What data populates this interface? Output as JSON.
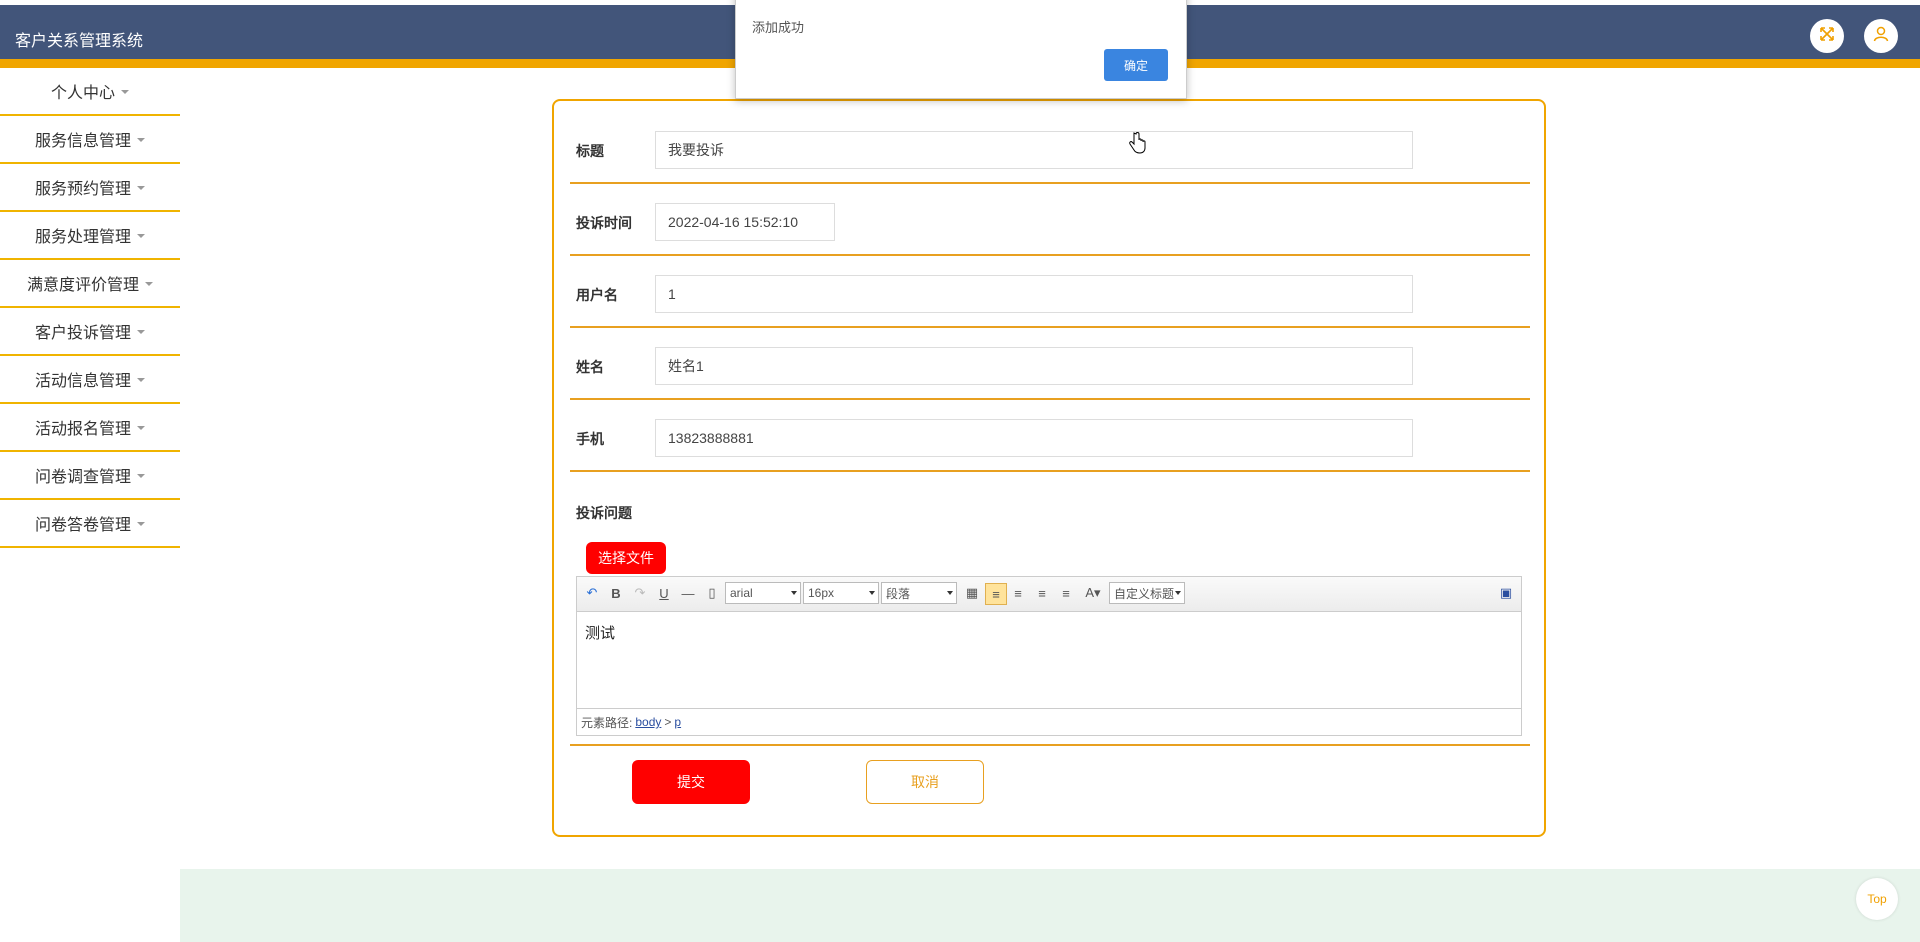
{
  "header": {
    "title": "客户关系管理系统"
  },
  "sidebar": {
    "items": [
      {
        "label": "个人中心"
      },
      {
        "label": "服务信息管理"
      },
      {
        "label": "服务预约管理"
      },
      {
        "label": "服务处理管理"
      },
      {
        "label": "满意度评价管理"
      },
      {
        "label": "客户投诉管理"
      },
      {
        "label": "活动信息管理"
      },
      {
        "label": "活动报名管理"
      },
      {
        "label": "问卷调查管理"
      },
      {
        "label": "问卷答卷管理"
      }
    ]
  },
  "form": {
    "fields": [
      {
        "label": "标题",
        "value": "我要投诉"
      },
      {
        "label": "投诉时间",
        "value": "2022-04-16 15:52:10"
      },
      {
        "label": "用户名",
        "value": "1"
      },
      {
        "label": "姓名",
        "value": "姓名1"
      },
      {
        "label": "手机",
        "value": "13823888881"
      }
    ],
    "complaint_label": "投诉问题",
    "choose_file": "选择文件",
    "editor": {
      "font": "arial",
      "size": "16px",
      "paragraph": "段落",
      "custom_title": "自定义标题",
      "content": "测试",
      "path_label": "元素路径:",
      "path_body": "body",
      "path_sep": ">",
      "path_p": "p"
    },
    "submit": "提交",
    "cancel": "取消"
  },
  "dialog": {
    "message": "添加成功",
    "ok": "确定"
  },
  "footer": {
    "top_button": "Top"
  },
  "colors": {
    "header": "#42557a",
    "accent": "#f0a500",
    "primary_button": "#ff0000",
    "dialog_button": "#3a85e0"
  }
}
